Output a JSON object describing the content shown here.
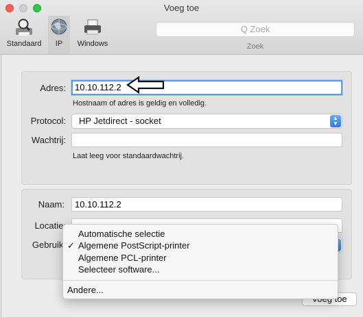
{
  "window": {
    "title": "Voeg toe"
  },
  "toolbar": {
    "buttons": [
      {
        "label": "Standaard",
        "icon": "magnifier-printer-icon"
      },
      {
        "label": "IP",
        "icon": "globe-icon",
        "selected": true
      },
      {
        "label": "Windows",
        "icon": "windows-printer-icon"
      }
    ],
    "search": {
      "placeholder": "Q Zoek",
      "label": "Zoek"
    }
  },
  "form": {
    "adres_label": "Adres:",
    "adres_value": "10.10.112.2",
    "adres_hint": "Hostnaam of adres is geldig en volledig.",
    "protocol_label": "Protocol:",
    "protocol_value": "HP Jetdirect - socket",
    "wachtrij_label": "Wachtrij:",
    "wachtrij_value": "",
    "wachtrij_hint": "Laat leeg voor standaardwachtrij.",
    "naam_label": "Naam:",
    "naam_value": "10.10.112.2",
    "locatie_label": "Locatie:",
    "locatie_value": "",
    "gebruik_label": "Gebruik:"
  },
  "menu": {
    "items": [
      {
        "label": "Automatische selectie",
        "checked": false
      },
      {
        "label": "Algemene PostScript-printer",
        "checked": true
      },
      {
        "label": "Algemene PCL-printer",
        "checked": false
      },
      {
        "label": "Selecteer software...",
        "checked": false
      }
    ],
    "extra": "Andere...",
    "check_mark": "✓"
  },
  "footer": {
    "add_button": "Voeg toe"
  },
  "colors": {
    "focus": "#5c9bde",
    "accent": "#2a7be6",
    "close": "#fc5f57",
    "zoom": "#30c748"
  }
}
